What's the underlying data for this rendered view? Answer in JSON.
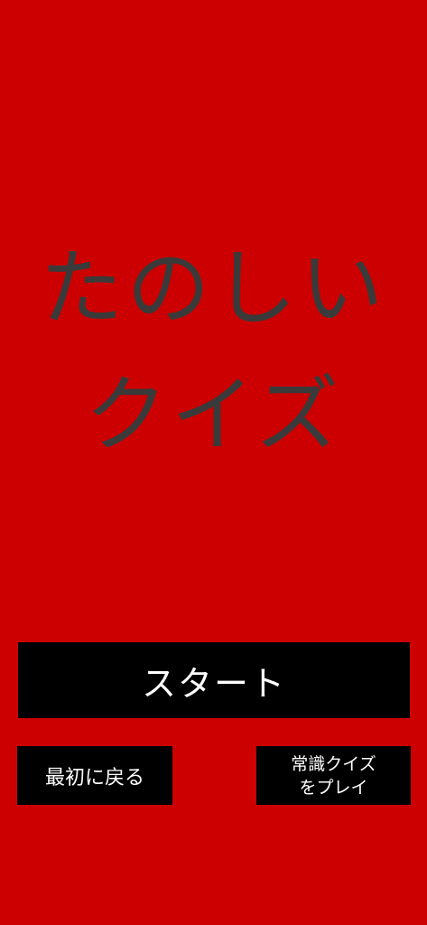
{
  "title": {
    "line1": "たのしい",
    "line2": "クイズ"
  },
  "buttons": {
    "start": "スタート",
    "back": "最初に戻る",
    "common_line1": "常識クイズ",
    "common_line2": "をプレイ"
  },
  "colors": {
    "background": "#cc0000",
    "title_text": "#3a3a3a",
    "button_bg": "#000000",
    "button_text": "#ffffff"
  }
}
